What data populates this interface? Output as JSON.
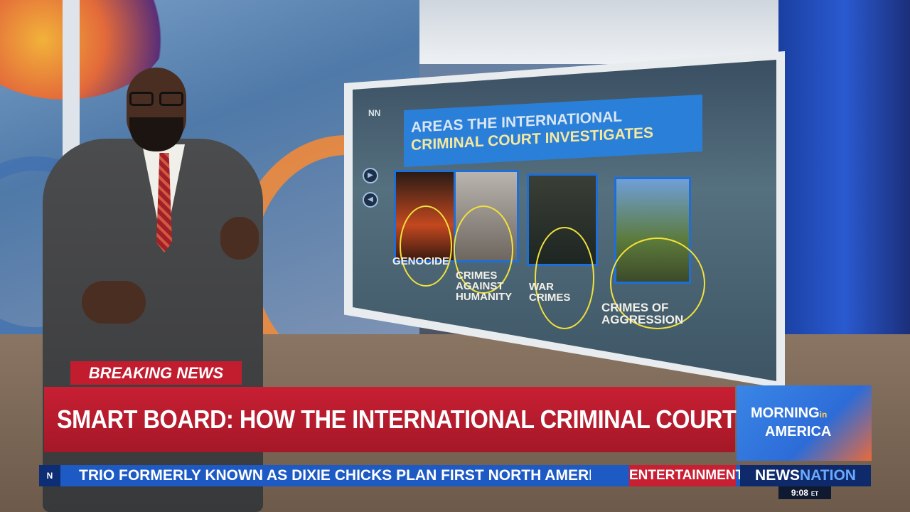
{
  "board": {
    "logo": "NN",
    "title_line1": "AREAS THE INTERNATIONAL",
    "title_line2": "CRIMINAL COURT INVESTIGATES",
    "categories": [
      {
        "line1": "GENOCIDE",
        "line2": "",
        "line3": ""
      },
      {
        "line1": "CRIMES",
        "line2": "AGAINST",
        "line3": "HUMANITY"
      },
      {
        "line1": "WAR",
        "line2": "CRIMES",
        "line3": ""
      },
      {
        "line1": "CRIMES OF",
        "line2": "AGGRESSION",
        "line3": ""
      }
    ],
    "accent_color": "#1e6ed8",
    "annotation_color": "#f2e23a"
  },
  "lower_third": {
    "label": "BREAKING NEWS",
    "headline": "SMART BOARD: HOW THE INTERNATIONAL CRIMINAL COURT WORKS",
    "label_color": "#c21d2f"
  },
  "show_logo": {
    "line1": "MORNING",
    "line1_small": "in",
    "line2": "AMERICA"
  },
  "ticker": {
    "logo": "N",
    "text": "TRIO FORMERLY KNOWN AS DIXIE CHICKS PLAN FIRST NORTH AMERIC",
    "category": "ENTERTAINMENT",
    "network_a": "NEWS",
    "network_b": "NATION"
  },
  "clock": {
    "time": "9:08",
    "zone": "ET"
  }
}
